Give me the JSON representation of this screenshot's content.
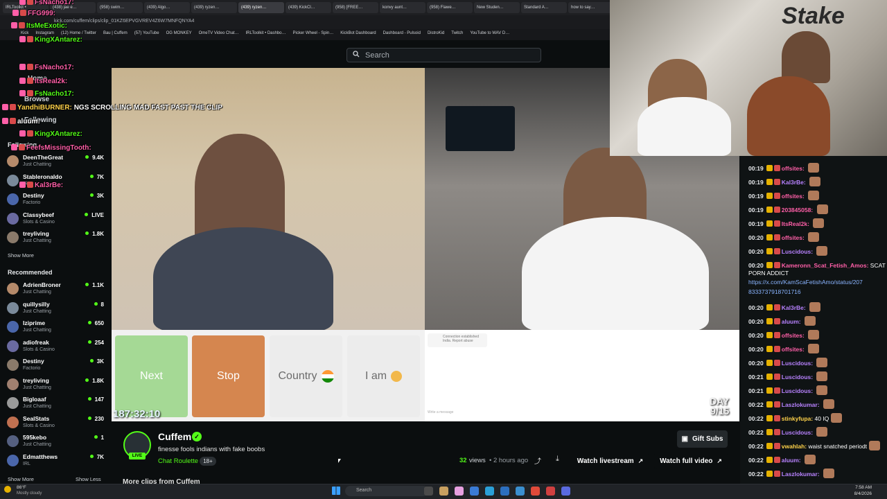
{
  "browser": {
    "tabs": [
      "IRLToolkit •",
      "(438) jae e…",
      "(958) swim…",
      "(439) Algo…",
      "(439) ryzen…",
      "(439) ryzen…",
      "(439) KickCl…",
      "(958) [FREE…",
      "konvy aunt…",
      "(958) Flawe…",
      "New Studen…",
      "Standard A…",
      "how to say…"
    ],
    "url": "kick.com/cuffem/clips/clip_01KZ6EPVGVREV4Z6W7MNFQNYA4",
    "bookmarks": [
      "Kick",
      "Instagram",
      "(12) Home / Twitter",
      "Bau | Cuffem",
      "(57) YouTube",
      "OG MONKEY",
      "OmeTV Video Chat…",
      "IRLToolkit • Dashbo…",
      "Picker Wheel - Spin…",
      "KickBot Dashboard",
      "Dashboard - Pulsoid",
      "DistroKid",
      "Twitch",
      "YouTube to WAV D…"
    ]
  },
  "search": {
    "placeholder": "Search"
  },
  "sidebar": {
    "following_title": "Following",
    "following": [
      {
        "name": "DeenTheGreat",
        "category": "Just Chatting",
        "viewers": "9.4K"
      },
      {
        "name": "Stableronaldo",
        "category": "IRL",
        "viewers": "7K"
      },
      {
        "name": "Destiny",
        "category": "Factorio",
        "viewers": "3K"
      },
      {
        "name": "Classybeef",
        "category": "Slots & Casino",
        "viewers": "LIVE"
      },
      {
        "name": "treyliving",
        "category": "Just Chatting",
        "viewers": "1.8K"
      }
    ],
    "show_more": "Show More",
    "recommended_title": "Recommended",
    "recommended": [
      {
        "name": "AdrienBroner",
        "category": "Just Chatting",
        "viewers": "1.1K"
      },
      {
        "name": "quillysilly",
        "category": "Just Chatting",
        "viewers": "8"
      },
      {
        "name": "Iziprime",
        "category": "Just Chatting",
        "viewers": "650"
      },
      {
        "name": "adiofreak",
        "category": "Slots & Casino",
        "viewers": "254"
      },
      {
        "name": "Destiny",
        "category": "Factorio",
        "viewers": "3K"
      },
      {
        "name": "treyliving",
        "category": "Just Chatting",
        "viewers": "1.8K"
      },
      {
        "name": "Bigloaaf",
        "category": "Just Chatting",
        "viewers": "147"
      },
      {
        "name": "SealStats",
        "category": "Slots & Casino",
        "viewers": "230"
      },
      {
        "name": "595kebo",
        "category": "Just Chatting",
        "viewers": "1"
      },
      {
        "name": "Edmatthews",
        "category": "IRL",
        "viewers": "7K"
      }
    ],
    "show_more_2": "Show More",
    "show_less": "Show Less",
    "nav": [
      "Home",
      "Browse",
      "Following"
    ]
  },
  "overlay_chat": [
    {
      "user": "FsNacho17:",
      "color": "#ff5fa8",
      "text": ""
    },
    {
      "user": "FFG999:",
      "color": "#ff5fa8",
      "text": ""
    },
    {
      "user": "ItsMeExotic:",
      "color": "#53fc18",
      "text": ""
    },
    {
      "user": "KingXAntarez:",
      "color": "#53fc18",
      "text": ""
    },
    {
      "user": "FsNacho17:",
      "color": "#ff5fa8",
      "text": ""
    },
    {
      "user": "ItsReal2k:",
      "color": "#ff5fa8",
      "text": ""
    },
    {
      "user": "FsNacho17:",
      "color": "#53fc18",
      "text": ""
    },
    {
      "user": "YandhiBURNER:",
      "color": "#ffd24a",
      "text": "NGS SCROLLING MAD FAST PAST THE CLIP"
    },
    {
      "user": "aluum:",
      "color": "#ffffff",
      "text": ""
    },
    {
      "user": "KingXAntarez:",
      "color": "#53fc18",
      "text": ""
    },
    {
      "user": "FeefsMissingTooth:",
      "color": "#ff5fa8",
      "text": ""
    },
    {
      "user": "Kal3rBe:",
      "color": "#ff5fa8",
      "text": ""
    }
  ],
  "video": {
    "controls": {
      "next": "Next",
      "stop": "Stop",
      "country": "Country",
      "iam": "I am"
    },
    "connection_text": "Connection established",
    "connection_sub": "India. Report abuse",
    "send_placeholder": "Write a message",
    "timer": "187:32:10",
    "day_counter": [
      "DAY",
      "9/15"
    ],
    "watermark": "Stake"
  },
  "right_chat": [
    {
      "time": "00:19",
      "user": "offsites:",
      "color": "#ff5fa8",
      "text": ""
    },
    {
      "time": "00:19",
      "user": "Kal3rBe:",
      "color": "#b882ff",
      "text": ""
    },
    {
      "time": "00:19",
      "user": "offsites:",
      "color": "#ff5fa8",
      "text": ""
    },
    {
      "time": "00:19",
      "user": "203845058:",
      "color": "#ff5fa8",
      "text": ""
    },
    {
      "time": "00:19",
      "user": "ItsReal2k:",
      "color": "#ff5fa8",
      "text": ""
    },
    {
      "time": "00:20",
      "user": "offsites:",
      "color": "#ff5fa8",
      "text": ""
    },
    {
      "time": "00:20",
      "user": "Luscidous:",
      "color": "#b882ff",
      "text": ""
    },
    {
      "time": "00:20",
      "user": "Kameronn_Scat_Fetish_Amos:",
      "color": "#ff5fa8",
      "text": "SCAT"
    },
    {
      "time": "",
      "user": "",
      "color": "#ffffff",
      "text": "PORN ADDICT"
    },
    {
      "time": "",
      "user": "",
      "color": "#8ab4ff",
      "text": "https://x.com/KamScaFetishAmo/status/207"
    },
    {
      "time": "",
      "user": "",
      "color": "#8ab4ff",
      "text": "8333737918701716"
    },
    {
      "time": "00:20",
      "user": "Kal3rBe:",
      "color": "#b882ff",
      "text": ""
    },
    {
      "time": "00:20",
      "user": "aluum:",
      "color": "#b882ff",
      "text": ""
    },
    {
      "time": "00:20",
      "user": "offsites:",
      "color": "#ff5fa8",
      "text": ""
    },
    {
      "time": "00:20",
      "user": "offsites:",
      "color": "#ff5fa8",
      "text": ""
    },
    {
      "time": "00:20",
      "user": "Luscidous:",
      "color": "#b882ff",
      "text": ""
    },
    {
      "time": "00:21",
      "user": "Luscidous:",
      "color": "#b882ff",
      "text": ""
    },
    {
      "time": "00:21",
      "user": "Luscidous:",
      "color": "#b882ff",
      "text": ""
    },
    {
      "time": "00:22",
      "user": "Laszlokumar:",
      "color": "#b882ff",
      "text": ""
    },
    {
      "time": "00:22",
      "user": "stinkyfupa:",
      "color": "#ffd24a",
      "text": "40 IQ"
    },
    {
      "time": "00:22",
      "user": "Luscidous:",
      "color": "#b882ff",
      "text": ""
    },
    {
      "time": "00:22",
      "user": "vwahlah:",
      "color": "#ffd24a",
      "text": "waist snatched periodt"
    },
    {
      "time": "00:22",
      "user": "aluum:",
      "color": "#b882ff",
      "text": ""
    },
    {
      "time": "00:22",
      "user": "Laszlokumar:",
      "color": "#b882ff",
      "text": ""
    }
  ],
  "clip": {
    "channel": "Cuffem",
    "live_label": "LIVE",
    "title": "finesse fools indians with fake boobs",
    "category": "Chat Roulette",
    "age_rating": "18+",
    "views": "32",
    "views_label": "views",
    "time_ago": "• 2 hours ago",
    "gift_subs": "Gift Subs",
    "watch_livestream": "Watch livestream",
    "watch_full_video": "Watch full video",
    "more_clips": "More clips from Cuffem"
  },
  "taskbar": {
    "weather_temp": "86°F",
    "weather_desc": "Mostly cloudy",
    "search_placeholder": "Search",
    "time": "7:58 AM",
    "date": "8/4/2026"
  },
  "colors": {
    "kick_green": "#53fc18",
    "bg": "#0b0e0f",
    "next_green": "#9fd98a",
    "stop_orange": "#d9874f"
  }
}
